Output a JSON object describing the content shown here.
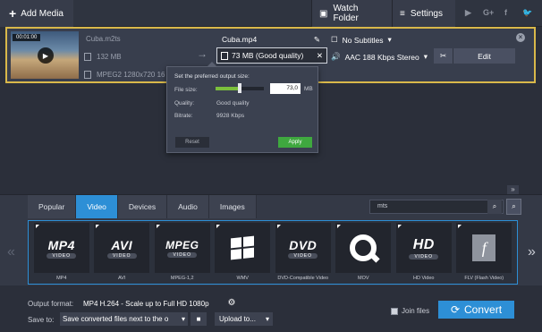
{
  "toolbar": {
    "add_media": "Add Media",
    "watch_folder": "Watch Folder",
    "settings": "Settings",
    "social": [
      "▶",
      "G+",
      "f",
      "🐦"
    ]
  },
  "file": {
    "thumb_time": "00:01:00",
    "source_name": "Cuba.m2ts",
    "source_size": "132 MB",
    "source_codec": "MPEG2 1280x720 16",
    "output_name": "Cuba.mp4",
    "output_size": "73 MB (Good quality)",
    "subtitles": "No Subtitles",
    "audio": "AAC 188 Kbps Stereo",
    "edit": "Edit"
  },
  "popup": {
    "header": "Set the preferred output size:",
    "file_size_label": "File size:",
    "file_size_value": "73,0",
    "file_size_unit": "MB",
    "slider_fraction": 0.5,
    "quality_label": "Quality:",
    "quality_value": "Good quality",
    "bitrate_label": "Bitrate:",
    "bitrate_value": "9928 Kbps",
    "reset": "Reset",
    "apply": "Apply"
  },
  "tabs": [
    {
      "label": "Popular",
      "active": false
    },
    {
      "label": "Video",
      "active": true
    },
    {
      "label": "Devices",
      "active": false
    },
    {
      "label": "Audio",
      "active": false
    },
    {
      "label": "Images",
      "active": false
    }
  ],
  "search": {
    "value": "mts"
  },
  "formats": [
    {
      "logo": "MP4",
      "sub": "VIDEO",
      "label": "MP4"
    },
    {
      "logo": "AVI",
      "sub": "VIDEO",
      "label": "AVI"
    },
    {
      "logo": "MPEG",
      "sub": "VIDEO",
      "label": "MPEG-1,2"
    },
    {
      "logo": "",
      "sub": "",
      "label": "WMV"
    },
    {
      "logo": "DVD",
      "sub": "VIDEO",
      "label": "DVD-Compatible Video"
    },
    {
      "logo": "",
      "sub": "",
      "label": "MOV"
    },
    {
      "logo": "HD",
      "sub": "VIDEO",
      "label": "HD Video"
    },
    {
      "logo": "f",
      "sub": "",
      "label": "FLV (Flash Video)"
    }
  ],
  "bottom": {
    "output_format_label": "Output format:",
    "output_format_value": "MP4 H.264 - Scale up to Full HD 1080p",
    "save_to_label": "Save to:",
    "save_to_value": "Save converted files next to the o",
    "upload": "Upload to...",
    "join_files": "Join files",
    "convert": "Convert"
  },
  "colors": {
    "accent": "#2d8fd6",
    "highlight": "#d9b84a",
    "apply": "#3fa83f"
  }
}
